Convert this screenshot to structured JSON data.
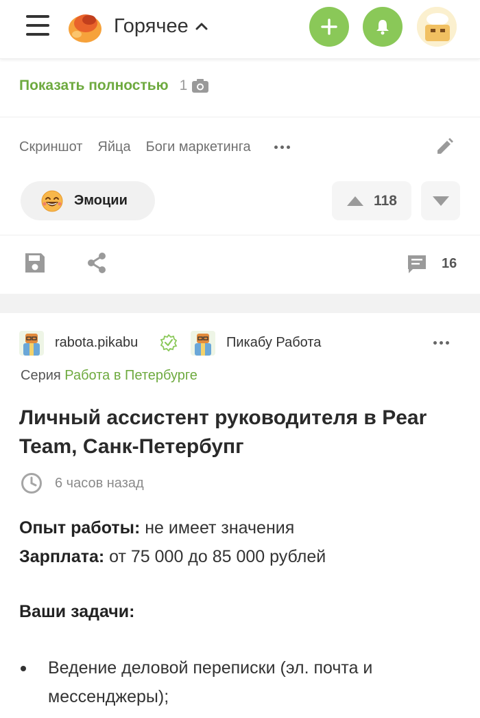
{
  "header": {
    "feed_label": "Горячее"
  },
  "post1": {
    "show_full": "Показать полностью",
    "photo_count": "1",
    "tags": [
      "Скриншот",
      "Яйца",
      "Боги маркетинга"
    ],
    "emotions_label": "Эмоции",
    "rating": "118",
    "comments_count": "16"
  },
  "post2": {
    "author": "rabota.pikabu",
    "community": "Пикабу Работа",
    "series_prefix": "Серия",
    "series_name": "Работа в Петербурге",
    "title": "Личный ассистент руководителя в Pear Team, Санк-Петербупг",
    "time": "6 часов назад",
    "experience_label": "Опыт работы:",
    "experience_value": " не имеет значения",
    "salary_label": "Зарплата:",
    "salary_value": " от 75 000 до 85 000 рублей",
    "tasks_heading": "Ваши задачи:",
    "tasks": [
      "Ведение деловой переписки (эл. почта и мессенджеры);"
    ]
  },
  "colors": {
    "accent_green": "#8ac858",
    "link_green": "#6eaa3f",
    "text_dark": "#222222",
    "text_muted": "#707070"
  },
  "icons": [
    "menu-icon",
    "pikabu-logo",
    "chevron-up-icon",
    "plus-icon",
    "bell-icon",
    "user-avatar",
    "camera-icon",
    "pencil-icon",
    "emoji-laugh-icon",
    "arrow-up-icon",
    "arrow-down-icon",
    "save-icon",
    "share-icon",
    "comment-icon",
    "verified-icon",
    "clock-icon"
  ]
}
